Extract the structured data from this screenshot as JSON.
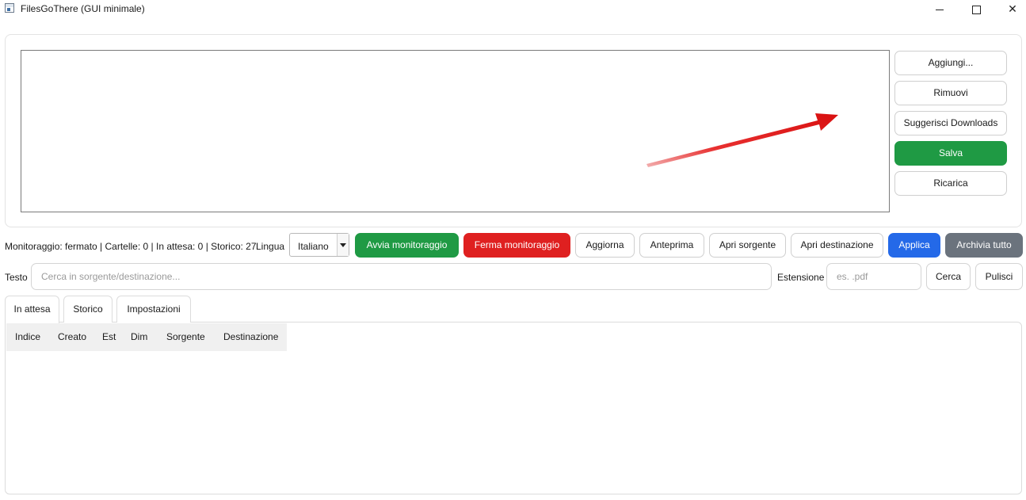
{
  "window": {
    "title": "FilesGoThere (GUI minimale)",
    "controls": [
      "minimize",
      "maximize",
      "close"
    ]
  },
  "folders": {
    "items": [],
    "side_buttons": {
      "add": "Aggiungi...",
      "remove": "Rimuovi",
      "suggest": "Suggerisci Downloads",
      "save": "Salva",
      "reload": "Ricarica"
    }
  },
  "status": {
    "text": "Monitoraggio: fermato | Cartelle: 0 | In attesa: 0 | Storico: 27",
    "language_label": "Lingua",
    "language_value": "Italiano"
  },
  "actions": {
    "start": "Avvia monitoraggio",
    "stop": "Ferma monitoraggio",
    "refresh": "Aggiorna",
    "preview": "Anteprima",
    "open_source": "Apri sorgente",
    "open_dest": "Apri destinazione",
    "apply": "Applica",
    "archive_all": "Archivia tutto"
  },
  "filters": {
    "text_label": "Testo",
    "text_placeholder": "Cerca in sorgente/destinazione...",
    "ext_label": "Estensione",
    "ext_placeholder": "es. .pdf",
    "search": "Cerca",
    "clear": "Pulisci"
  },
  "tabs": [
    {
      "label": "In attesa"
    },
    {
      "label": "Storico"
    },
    {
      "label": "Impostazioni"
    }
  ],
  "table": {
    "columns": [
      "Indice",
      "Creato",
      "Est",
      "Dim",
      "Sorgente",
      "Destinazione"
    ],
    "rows": []
  },
  "colors": {
    "green": "#1f9a44",
    "red": "#df2020",
    "blue": "#2469e8",
    "gray": "#6b737d",
    "annotation_arrow": "#e31b1b"
  }
}
